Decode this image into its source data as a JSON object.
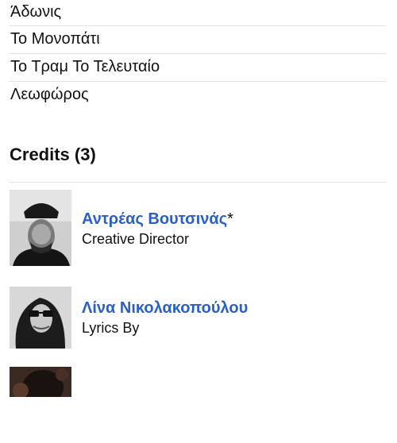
{
  "tracklist": {
    "tracks": [
      "Άδωνις",
      "Το Μονοπάτι",
      "Το Τραμ Το Τελευταίο",
      "Λεωφώρος"
    ]
  },
  "credits": {
    "heading": "Credits (3)",
    "items": [
      {
        "name": "Αντρέας Βουτσινάς",
        "suffix": "*",
        "role": "Creative Director"
      },
      {
        "name": "Λίνα Νικολακοπούλου",
        "suffix": "",
        "role": "Lyrics By"
      }
    ]
  },
  "colors": {
    "link": "#2c5fc4",
    "divider": "#e2e2e2",
    "text": "#111111"
  },
  "icons": {
    "credit_1_photo": "person-photo-icon",
    "credit_2_photo": "person-photo-icon",
    "credit_3_photo": "person-photo-icon"
  }
}
